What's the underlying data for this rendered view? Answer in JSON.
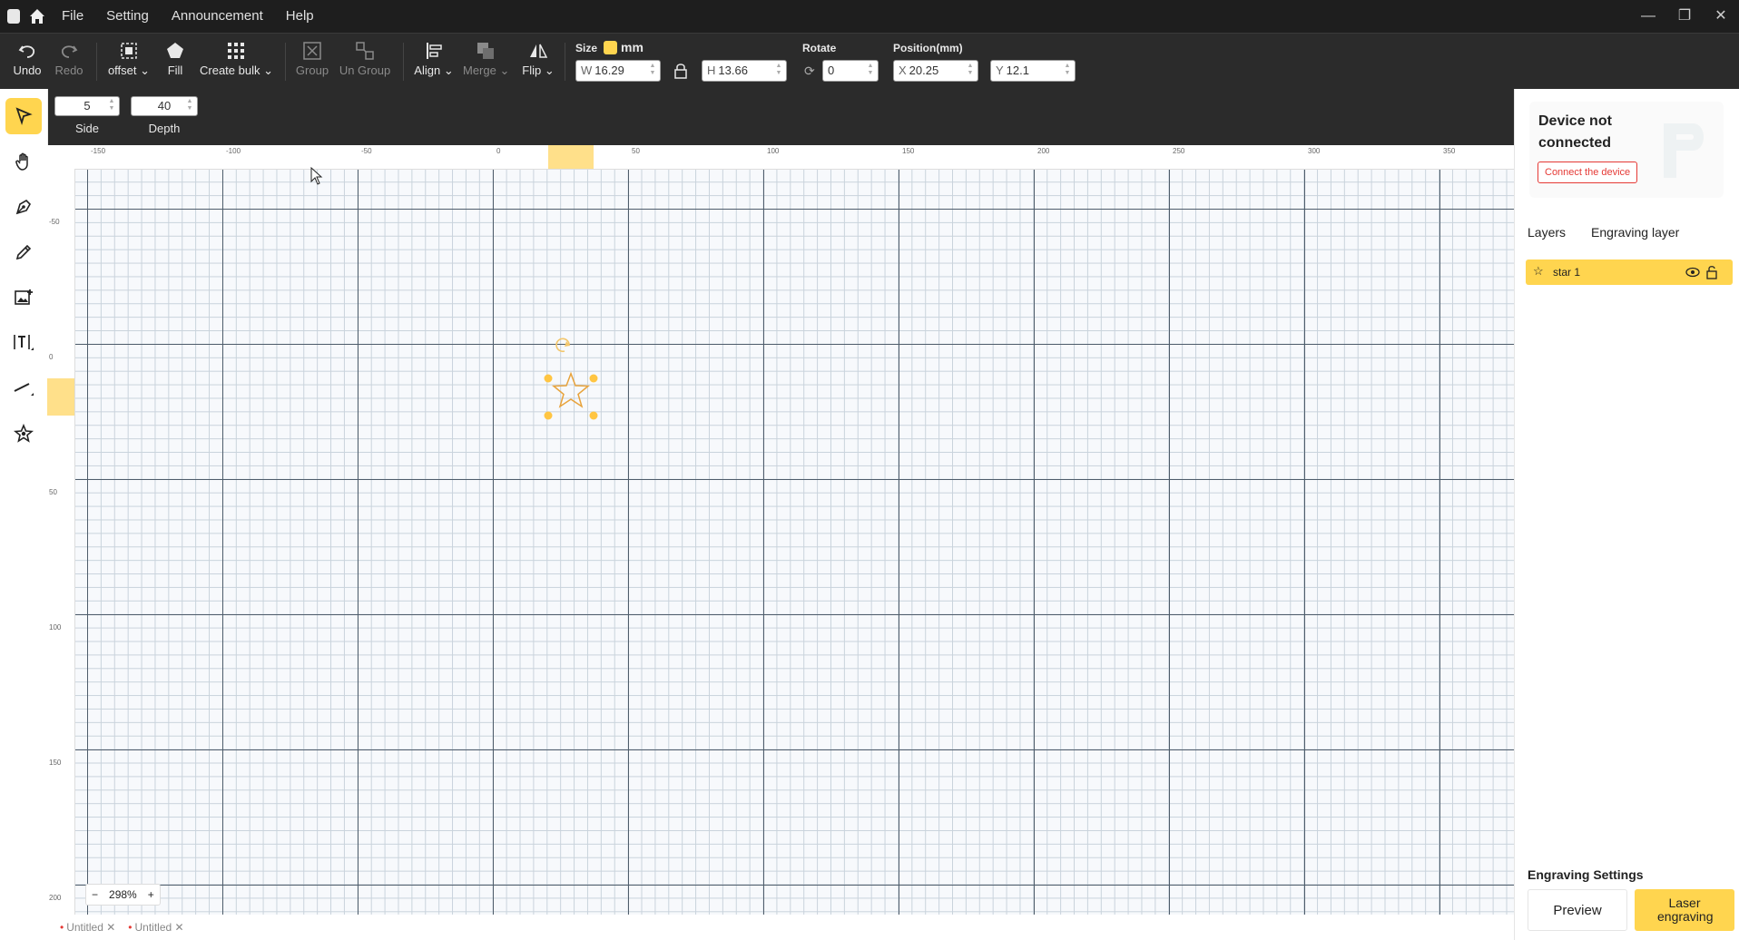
{
  "menu": [
    "File",
    "Setting",
    "Announcement",
    "Help"
  ],
  "toolbar": {
    "undo": "Undo",
    "redo": "Redo",
    "offset": "offset",
    "fill": "Fill",
    "create_bulk": "Create bulk",
    "group": "Group",
    "ungroup": "Un Group",
    "align": "Align",
    "merge": "Merge",
    "flip": "Flip",
    "size_label": "Size",
    "unit": "mm",
    "w_prefix": "W",
    "w_value": "16.29",
    "h_prefix": "H",
    "h_value": "13.66",
    "rotate_label": "Rotate",
    "rotate_value": "0",
    "position_label": "Position(mm)",
    "x_prefix": "X",
    "x_value": "20.25",
    "y_prefix": "Y",
    "y_value": "12.1"
  },
  "shape_params": {
    "side_value": "5",
    "side_label": "Side",
    "depth_value": "40",
    "depth_label": "Depth"
  },
  "ruler": {
    "top_ticks": [
      "-150",
      "-100",
      "-50",
      "0",
      "50",
      "100",
      "150",
      "200",
      "250",
      "300",
      "350"
    ],
    "left_ticks": [
      "-50",
      "0",
      "50",
      "100",
      "150",
      "200"
    ]
  },
  "device": {
    "status": "Device not connected",
    "connect_button": "Connect the device"
  },
  "tabs": [
    "Layers",
    "Engraving layer"
  ],
  "layers": [
    {
      "name": "star 1"
    }
  ],
  "engraving": {
    "title": "Engraving Settings",
    "preview": "Preview",
    "laser": "Laser engraving"
  },
  "zoom": {
    "minus": "−",
    "value": "298%",
    "plus": "+"
  },
  "file_tabs": [
    "Untitled",
    "Untitled"
  ],
  "colors": {
    "accent": "#ffd54f",
    "star_stroke": "#e8a33c",
    "connect_red": "#e53935"
  }
}
